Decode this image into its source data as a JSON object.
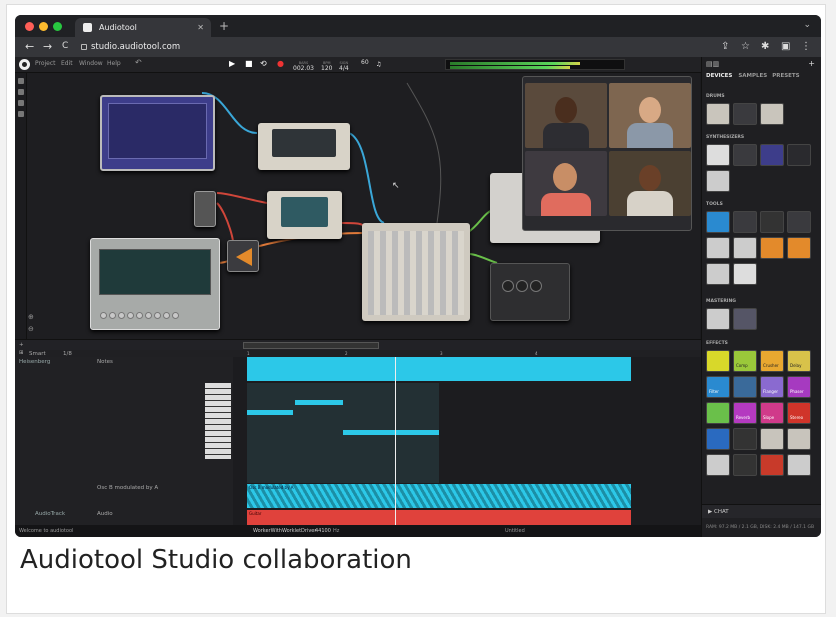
{
  "browser": {
    "tab_title": "Audiotool",
    "new_tab": "+",
    "url": "studio.audiotool.com",
    "back": "←",
    "forward": "→",
    "reload": "C",
    "tab_chevron": "⌄",
    "icons": [
      "share-icon",
      "star-icon",
      "extensions-icon",
      "sidebar-icon",
      "more-icon"
    ]
  },
  "app": {
    "menu": [
      "Project",
      "Edit",
      "Window",
      "Help"
    ],
    "undo": "↶",
    "transport": {
      "play": "▶",
      "stop": "■",
      "loop": "⟲",
      "record": "●"
    },
    "position": {
      "label": "BARS",
      "value": "002.03"
    },
    "bpm": {
      "label": "BPM",
      "value": "120"
    },
    "signature": {
      "label": "SIGN",
      "value": "4/4"
    },
    "zoom": {
      "label": "",
      "value": "60"
    }
  },
  "right_panel": {
    "tabs": [
      "DEVICES",
      "SAMPLES",
      "PRESETS"
    ],
    "sections": [
      "DRUMS",
      "SYNTHESIZERS",
      "TOOLS",
      "MASTERING",
      "EFFECTS"
    ],
    "effect_labels": [
      "Comp",
      "Crusher",
      "Delay",
      "Filter",
      "Flanger",
      "Phaser",
      "Reverb",
      "Slope",
      "Stereo"
    ],
    "chat": "CHAT",
    "ram": "RAM: 97.2 MB / 2.1 GB, DISK: 2.4 MB / 147.1 GB"
  },
  "timeline": {
    "smart": "Smart",
    "quantize": "1/8",
    "ruler": [
      "1",
      "2",
      "3",
      "4"
    ],
    "tracks": [
      {
        "name": "Heisenberg",
        "lane": "Notes"
      },
      {
        "name": "",
        "lane": "Osc B modulated by A",
        "clip": "Osc B modulated by A"
      },
      {
        "name": "AudioTrack",
        "lane": "Audio",
        "clip": "Guitar"
      }
    ]
  },
  "status": {
    "welcome": "Welcome to audiotool",
    "driver": "WorkerWithWorkletDriver",
    "rate": "44100",
    "rate_unit": "Hz",
    "project": "Untitled"
  },
  "cams": [
    "",
    "",
    "",
    ""
  ],
  "caption": "Audiotool Studio collaboration"
}
